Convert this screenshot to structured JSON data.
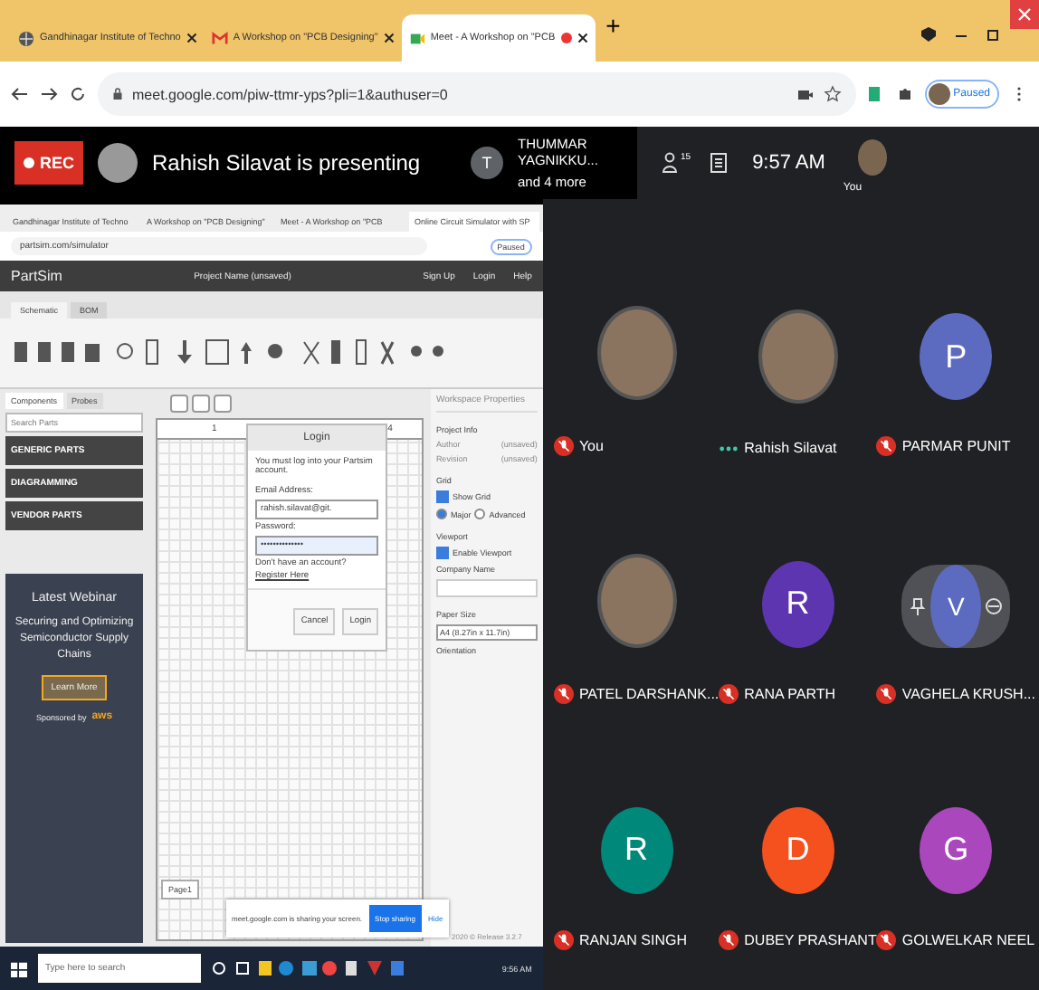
{
  "browser": {
    "tabs": [
      {
        "title": "Gandhinagar Institute of Techno",
        "kind": "globe",
        "selected": false,
        "recording": false
      },
      {
        "title": "A Workshop on \"PCB Designing\"",
        "kind": "mail",
        "selected": false,
        "recording": false
      },
      {
        "title": "Meet - A Workshop on \"PCB",
        "kind": "meet",
        "selected": true,
        "recording": true
      }
    ],
    "new_tab": "+",
    "address": "meet.google.com/piw-ttmr-yps?pli=1&authuser=0",
    "profile_status": "Paused"
  },
  "meet_bar": {
    "recording_label": "REC",
    "presenter_text": "Rahish Silavat is presenting",
    "viewer_initial": "T",
    "viewer_name": "THUMMAR YAGNIKKU...",
    "viewer_more": "and 4 more",
    "participant_count": "15",
    "time": "9:57 AM",
    "self_label": "You"
  },
  "shared_screen": {
    "tabs": [
      {
        "title": "Gandhinagar Institute of Techno",
        "selected": false
      },
      {
        "title": "A Workshop on \"PCB Designing\"",
        "selected": false
      },
      {
        "title": "Meet - A Workshop on \"PCB",
        "selected": false
      },
      {
        "title": "Online Circuit Simulator with SP",
        "selected": true
      }
    ],
    "address": "partsim.com/simulator",
    "profile_status": "Paused",
    "app_name": "PartSim",
    "project_name": "Project Name (unsaved)",
    "header_links": [
      "Sign Up",
      "Login",
      "Help"
    ],
    "ribbon_tabs": [
      {
        "label": "Schematic",
        "selected": true
      },
      {
        "label": "BOM",
        "selected": false
      }
    ],
    "side_tabs": [
      {
        "label": "Components",
        "selected": true
      },
      {
        "label": "Probes",
        "selected": false
      }
    ],
    "search_placeholder": "Search Parts",
    "categories": [
      "GENERIC PARTS",
      "DIAGRAMMING",
      "VENDOR PARTS"
    ],
    "ad": {
      "title": "Latest Webinar",
      "text": "Securing and Optimizing Semiconductor Supply Chains",
      "button": "Learn More",
      "sponsor": "Sponsored by",
      "sponsor_name": "aws"
    },
    "canvas": {
      "columns": [
        "1",
        "4"
      ],
      "page_tab": "Page1"
    },
    "login": {
      "title": "Login",
      "message": "You must log into your Partsim account.",
      "email_label": "Email Address:",
      "email_value": "rahish.silavat@git.",
      "password_label": "Password:",
      "password_value": "••••••••••••••",
      "signup_text": "Don't have an account?",
      "register_link": "Register Here",
      "buttons": [
        "Cancel",
        "Login"
      ]
    },
    "properties": {
      "title": "Workspace Properties",
      "project_info": "Project Info",
      "fields": [
        {
          "label": "Author",
          "value": "(unsaved)"
        },
        {
          "label": "Revision",
          "value": "(unsaved)"
        }
      ],
      "grid_title": "Grid",
      "show_grid": {
        "label": "Show Grid",
        "checked": true
      },
      "grid_modes": [
        {
          "label": "Major",
          "selected": true
        },
        {
          "label": "Advanced",
          "selected": false
        }
      ],
      "viewport_title": "Viewport",
      "enable_viewport": {
        "label": "Enable Viewport",
        "checked": true
      },
      "company_label": "Company Name",
      "paper_label": "Paper Size",
      "paper_value": "A4 (8.27in x 11.7in)",
      "orientation_label": "Orientation",
      "release": "2020 © Release 3.2.7"
    },
    "share_bar": {
      "text": "meet.google.com is sharing your screen.",
      "stop": "Stop sharing",
      "hide": "Hide"
    },
    "taskbar": {
      "search_placeholder": "Type here to search",
      "time": "9:56 AM"
    }
  },
  "participants": [
    {
      "name": "You",
      "kind": "photo",
      "muted": true
    },
    {
      "name": "Rahish Silavat",
      "kind": "photo",
      "muted": false
    },
    {
      "name": "PARMAR PUNIT",
      "kind": "letter",
      "initial": "P",
      "color": "#5c6bc0",
      "muted": true
    },
    {
      "name": "PATEL DARSHANK...",
      "kind": "photo",
      "muted": true
    },
    {
      "name": "RANA PARTH",
      "kind": "letter",
      "initial": "R",
      "color": "#5e35b1",
      "muted": true
    },
    {
      "name": "VAGHELA KRUSH...",
      "kind": "hover",
      "initial": "V",
      "color": "#5c6bc0",
      "muted": true
    },
    {
      "name": "RANJAN SINGH",
      "kind": "letter",
      "initial": "R",
      "color": "#00897b",
      "muted": true
    },
    {
      "name": "DUBEY PRASHANT",
      "kind": "letter",
      "initial": "D",
      "color": "#f4511e",
      "muted": true
    },
    {
      "name": "GOLWELKAR NEEL",
      "kind": "letter",
      "initial": "G",
      "color": "#ab47bc",
      "muted": true
    }
  ]
}
